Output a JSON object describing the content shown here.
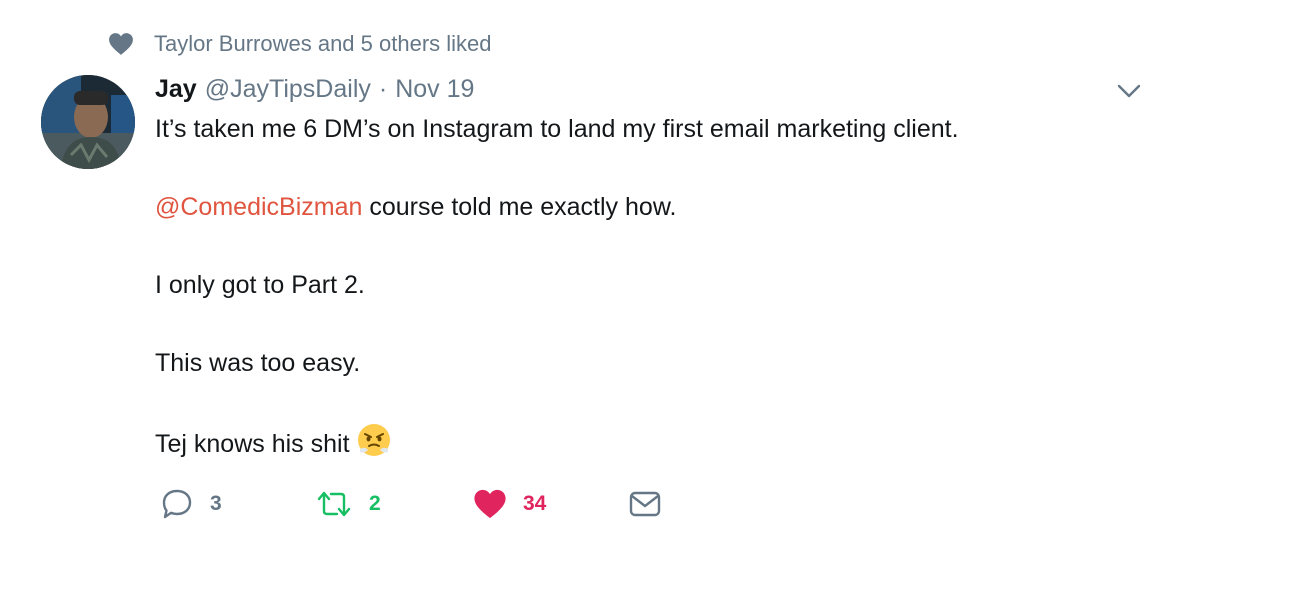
{
  "context": {
    "text": "Taylor Burrowes and 5 others liked",
    "icon": "heart-icon"
  },
  "tweet": {
    "name": "Jay",
    "handle": "@JayTipsDaily",
    "separator": "·",
    "date": "Nov 19",
    "paragraphs": [
      "It’s taken me 6 DM’s on Instagram to land my first email marketing client.",
      "course told me exactly how.",
      "I only got to Part 2.",
      "This was too easy.",
      "Tej knows his shit"
    ],
    "mention": "@ComedicBizman",
    "emoji": "face-with-steam-from-nose-emoji"
  },
  "actions": {
    "reply_count": "3",
    "retweet_count": "2",
    "like_count": "34"
  },
  "colors": {
    "secondary_text": "#657786",
    "mention": "#e0553f",
    "retweet_green": "#17bf63",
    "like_red": "#e0245e"
  }
}
